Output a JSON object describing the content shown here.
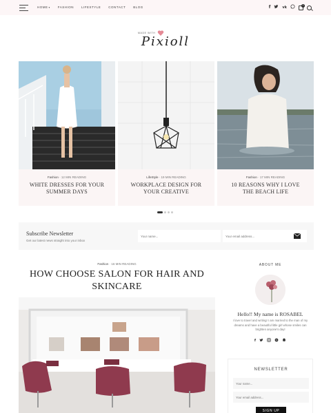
{
  "nav": {
    "items": [
      "HOME",
      "FASHION",
      "LIFESTYLE",
      "CONTACT",
      "BLOG"
    ],
    "cart_count": "1",
    "social_icons": [
      "facebook-icon",
      "twitter-icon",
      "vk-icon",
      "whatsapp-icon"
    ]
  },
  "logo": {
    "small": "MADE WITH",
    "script": "Pixioll"
  },
  "slider": {
    "slides": [
      {
        "category": "Fashion",
        "reading": "12 MIN READING",
        "title": "WHITE DRESSES FOR YOUR SUMMER DAYS"
      },
      {
        "category": "LifeStyle",
        "reading": "19 MIN READING",
        "title": "WORKPLACE DESIGN FOR YOUR CREATIVE"
      },
      {
        "category": "Fashion",
        "reading": "17 MIN READING",
        "title": "10 REASONS WHY I LOVE THE BEACH LIFE"
      }
    ]
  },
  "subscribe": {
    "title": "Subscribe Newsletter",
    "desc": "Get our latest news straight into your inbox",
    "name_placeholder": "Your name...",
    "email_placeholder": "Your email address..."
  },
  "post": {
    "category": "Fashion",
    "reading": "16 MIN READING",
    "title": "HOW CHOOSE SALON FOR HAIR AND SKINCARE"
  },
  "sidebar": {
    "about_label": "ABOUT ME",
    "name": "Hello!! My name is ROSABEL",
    "text": "I love to travel and writing! I am married to the man of my dreams and have a beautiful little girl whose smiles can brighten anyone's day!",
    "newsletter_title": "NEWSLETTER",
    "name_placeholder": "Your name...",
    "email_placeholder": "Your email address...",
    "signup": "SIGN UP"
  },
  "colors": {
    "topbar": "#fdf6f7",
    "accent_heart": "#e58a96",
    "slide_bg": "#fbf5f5"
  }
}
